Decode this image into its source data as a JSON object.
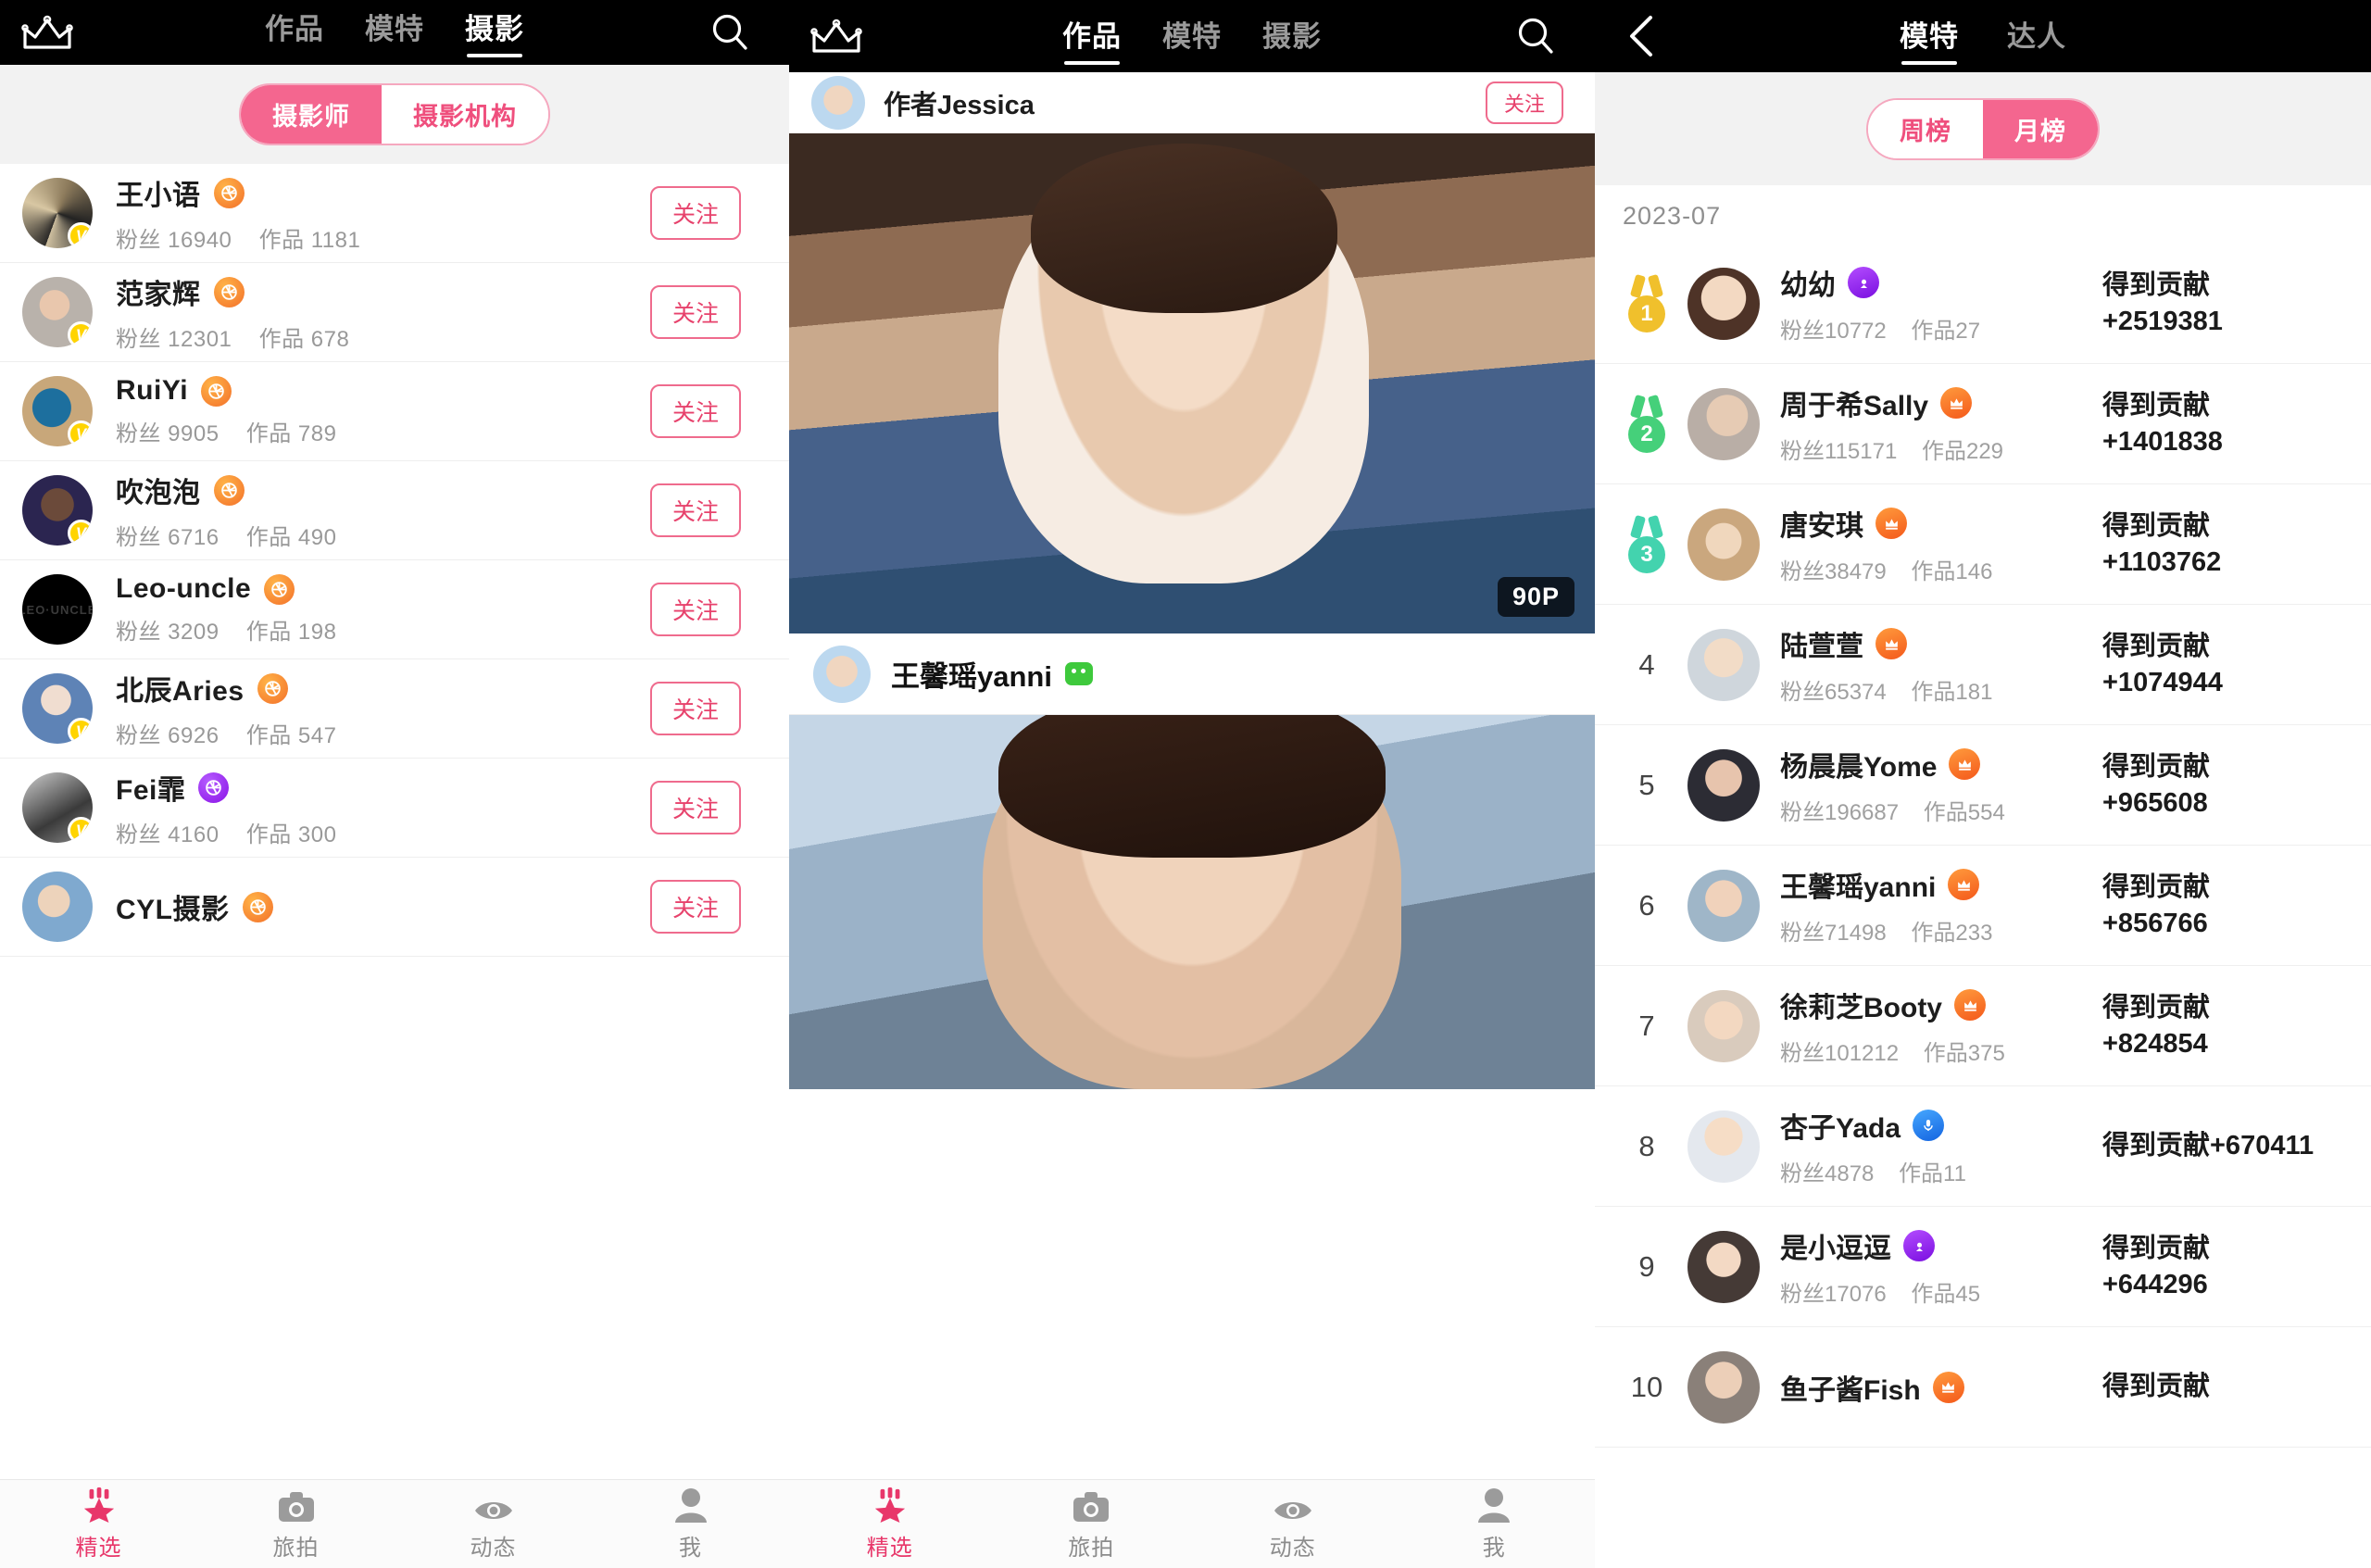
{
  "panel1": {
    "topnav": {
      "crown_icon": "crown-icon",
      "search_icon": "search-icon",
      "tabs": [
        {
          "label": "作品",
          "active": false
        },
        {
          "label": "模特",
          "active": false
        },
        {
          "label": "摄影",
          "active": true
        }
      ]
    },
    "segment": {
      "left": "摄影师",
      "right": "摄影机构",
      "selected": "摄影师"
    },
    "follow_label": "关注",
    "fans_label": "粉丝",
    "works_label": "作品",
    "verified_mark": "V",
    "photographers": [
      {
        "name": "王小语",
        "fans": "16940",
        "works": "1181",
        "badge": "orange",
        "verified": true,
        "avatar": "a1"
      },
      {
        "name": "范家辉",
        "fans": "12301",
        "works": "678",
        "badge": "orange",
        "verified": true,
        "avatar": "a2"
      },
      {
        "name": "RuiYi",
        "fans": "9905",
        "works": "789",
        "badge": "orange",
        "verified": true,
        "avatar": "a3"
      },
      {
        "name": "吹泡泡",
        "fans": "6716",
        "works": "490",
        "badge": "orange",
        "verified": true,
        "avatar": "a4"
      },
      {
        "name": "Leo-uncle",
        "fans": "3209",
        "works": "198",
        "badge": "orange",
        "verified": false,
        "avatar": "a5"
      },
      {
        "name": "北辰Aries",
        "fans": "6926",
        "works": "547",
        "badge": "orange",
        "verified": true,
        "avatar": "a6"
      },
      {
        "name": "Fei霏",
        "fans": "4160",
        "works": "300",
        "badge": "purple",
        "verified": true,
        "avatar": "a7"
      },
      {
        "name": "CYL摄影",
        "fans": "",
        "works": "",
        "badge": "orange",
        "verified": false,
        "avatar": "a8"
      }
    ],
    "tabbar": [
      {
        "label": "精选",
        "icon": "star-badge-icon",
        "active": true
      },
      {
        "label": "旅拍",
        "icon": "camera-icon",
        "active": false
      },
      {
        "label": "动态",
        "icon": "eye-icon",
        "active": false
      },
      {
        "label": "我",
        "icon": "person-icon",
        "active": false
      }
    ]
  },
  "panel2": {
    "topnav": {
      "crown_icon": "crown-icon",
      "search_icon": "search-icon",
      "tabs": [
        {
          "label": "作品",
          "active": true
        },
        {
          "label": "模特",
          "active": false
        },
        {
          "label": "摄影",
          "active": false
        }
      ]
    },
    "partial_top_author": "作者Jessica",
    "partial_top_follow": "关注",
    "post": {
      "page_badge": "90P",
      "author": "王馨瑶yanni",
      "wechat_icon": "wechat-icon"
    },
    "tabbar": [
      {
        "label": "精选",
        "icon": "star-badge-icon",
        "active": true
      },
      {
        "label": "旅拍",
        "icon": "camera-icon",
        "active": false
      },
      {
        "label": "动态",
        "icon": "eye-icon",
        "active": false
      },
      {
        "label": "我",
        "icon": "person-icon",
        "active": false
      }
    ]
  },
  "panel3": {
    "topnav": {
      "back_icon": "back-chevron-icon",
      "tabs": [
        {
          "label": "模特",
          "active": true
        },
        {
          "label": "达人",
          "active": false
        }
      ]
    },
    "segment": {
      "left": "周榜",
      "right": "月榜",
      "selected": "月榜"
    },
    "date": "2023-07",
    "contrib_label": "得到贡献",
    "fans_label": "粉丝",
    "works_label": "作品",
    "ranking": [
      {
        "rank": "1",
        "medal": "gold",
        "name": "幼幼",
        "fans": "10772",
        "works": "27",
        "tag": "purple",
        "contrib": "+2519381",
        "avatar": "r1"
      },
      {
        "rank": "2",
        "medal": "silver",
        "name": "周于希Sally",
        "fans": "115171",
        "works": "229",
        "tag": "orange",
        "contrib": "+1401838",
        "avatar": "r2"
      },
      {
        "rank": "3",
        "medal": "bronze",
        "name": "唐安琪",
        "fans": "38479",
        "works": "146",
        "tag": "orange",
        "contrib": "+1103762",
        "avatar": "r3"
      },
      {
        "rank": "4",
        "medal": "",
        "name": "陆萱萱",
        "fans": "65374",
        "works": "181",
        "tag": "orange",
        "contrib": "+1074944",
        "avatar": "r4"
      },
      {
        "rank": "5",
        "medal": "",
        "name": "杨晨晨Yome",
        "fans": "196687",
        "works": "554",
        "tag": "orange",
        "contrib": "+965608",
        "avatar": "r5"
      },
      {
        "rank": "6",
        "medal": "",
        "name": "王馨瑶yanni",
        "fans": "71498",
        "works": "233",
        "tag": "orange",
        "contrib": "+856766",
        "avatar": "r6"
      },
      {
        "rank": "7",
        "medal": "",
        "name": "徐莉芝Booty",
        "fans": "101212",
        "works": "375",
        "tag": "orange",
        "contrib": "+824854",
        "avatar": "r7"
      },
      {
        "rank": "8",
        "medal": "",
        "name": "杏子Yada",
        "fans": "4878",
        "works": "11",
        "tag": "blue",
        "contrib": "+670411",
        "avatar": "r8",
        "inline": true
      },
      {
        "rank": "9",
        "medal": "",
        "name": "是小逗逗",
        "fans": "17076",
        "works": "45",
        "tag": "purple",
        "contrib": "+644296",
        "avatar": "r9"
      },
      {
        "rank": "10",
        "medal": "",
        "name": "鱼子酱Fish",
        "fans": "",
        "works": "",
        "tag": "orange",
        "contrib": "",
        "avatar": "r10"
      }
    ]
  }
}
